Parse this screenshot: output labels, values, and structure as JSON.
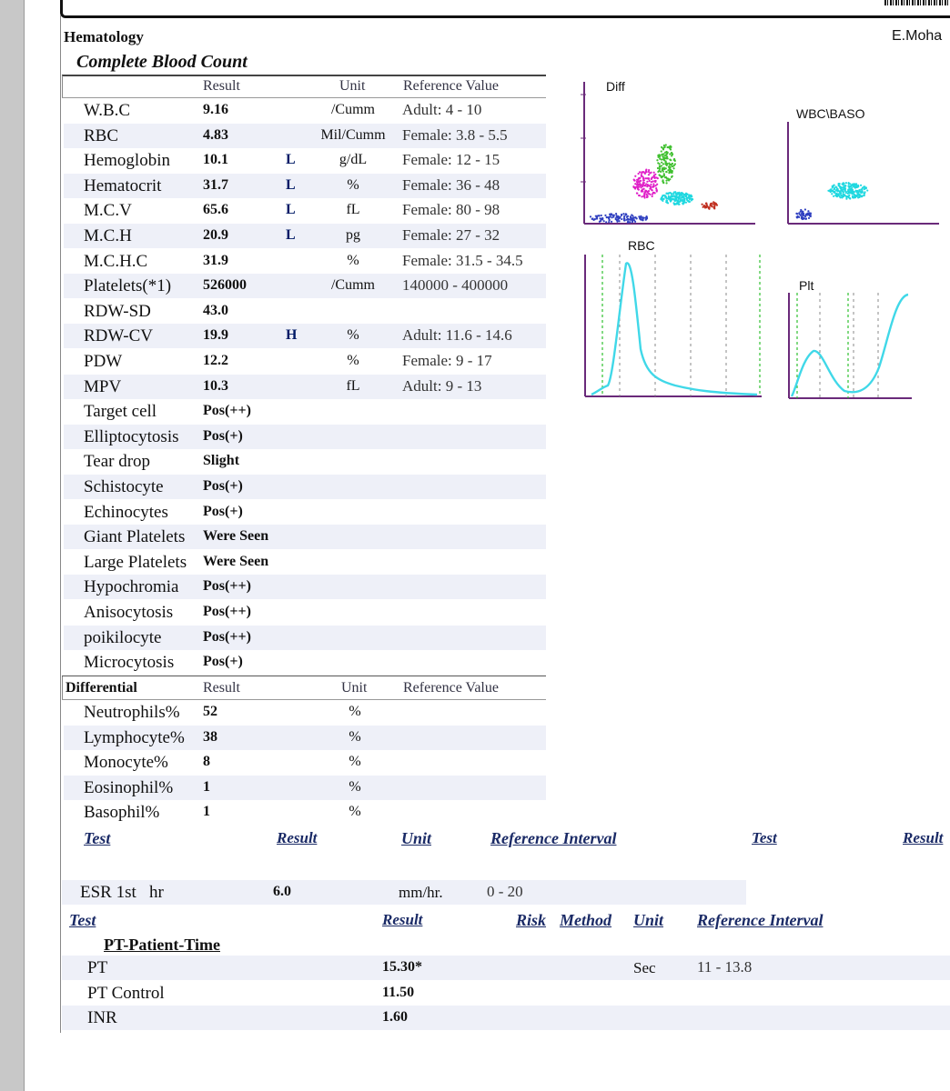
{
  "header": {
    "section": "Hematology",
    "author": "E.Moha"
  },
  "cbc": {
    "title": "Complete Blood Count",
    "col_result": "Result",
    "col_unit": "Unit",
    "col_ref": "Reference Value",
    "rows": [
      {
        "name": "W.B.C",
        "result": "9.16",
        "flag": "",
        "unit": "/Cumm",
        "ref": "Adult: 4 - 10"
      },
      {
        "name": "RBC",
        "result": "4.83",
        "flag": "",
        "unit": "Mil/Cumm",
        "ref": "Female: 3.8 - 5.5"
      },
      {
        "name": "Hemoglobin",
        "result": "10.1",
        "flag": "L",
        "unit": "g/dL",
        "ref": "Female: 12 - 15"
      },
      {
        "name": "Hematocrit",
        "result": "31.7",
        "flag": "L",
        "unit": "%",
        "ref": "Female: 36 - 48"
      },
      {
        "name": "M.C.V",
        "result": "65.6",
        "flag": "L",
        "unit": "fL",
        "ref": "Female: 80 - 98"
      },
      {
        "name": "M.C.H",
        "result": "20.9",
        "flag": "L",
        "unit": "pg",
        "ref": "Female: 27 - 32"
      },
      {
        "name": "M.C.H.C",
        "result": "31.9",
        "flag": "",
        "unit": "%",
        "ref": "Female: 31.5 - 34.5"
      },
      {
        "name": "Platelets(*1)",
        "result": "526000",
        "flag": "",
        "unit": "/Cumm",
        "ref": "140000 - 400000"
      },
      {
        "name": "RDW-SD",
        "result": "43.0",
        "flag": "",
        "unit": "",
        "ref": ""
      },
      {
        "name": "RDW-CV",
        "result": "19.9",
        "flag": "H",
        "unit": "%",
        "ref": "Adult: 11.6 - 14.6"
      },
      {
        "name": "PDW",
        "result": "12.2",
        "flag": "",
        "unit": "%",
        "ref": "Female: 9 - 17"
      },
      {
        "name": "MPV",
        "result": "10.3",
        "flag": "",
        "unit": "fL",
        "ref": "Adult: 9 - 13"
      },
      {
        "name": "Target cell",
        "result": "Pos(++)",
        "flag": "",
        "unit": "",
        "ref": ""
      },
      {
        "name": "Elliptocytosis",
        "result": "Pos(+)",
        "flag": "",
        "unit": "",
        "ref": ""
      },
      {
        "name": "Tear drop",
        "result": "Slight",
        "flag": "",
        "unit": "",
        "ref": ""
      },
      {
        "name": "Schistocyte",
        "result": "Pos(+)",
        "flag": "",
        "unit": "",
        "ref": ""
      },
      {
        "name": "Echinocytes",
        "result": "Pos(+)",
        "flag": "",
        "unit": "",
        "ref": ""
      },
      {
        "name": "Giant Platelets",
        "result": "Were Seen",
        "flag": "",
        "unit": "",
        "ref": ""
      },
      {
        "name": "Large Platelets",
        "result": "Were Seen",
        "flag": "",
        "unit": "",
        "ref": ""
      },
      {
        "name": "Hypochromia",
        "result": "Pos(++)",
        "flag": "",
        "unit": "",
        "ref": ""
      },
      {
        "name": "Anisocytosis",
        "result": "Pos(++)",
        "flag": "",
        "unit": "",
        "ref": ""
      },
      {
        "name": "poikilocyte",
        "result": "Pos(++)",
        "flag": "",
        "unit": "",
        "ref": ""
      },
      {
        "name": "Microcytosis",
        "result": "Pos(+)",
        "flag": "",
        "unit": "",
        "ref": ""
      }
    ]
  },
  "differential": {
    "title": "Differential",
    "col_result": "Result",
    "col_unit": "Unit",
    "col_ref": "Reference Value",
    "rows": [
      {
        "name": "Neutrophils%",
        "result": "52",
        "unit": "%"
      },
      {
        "name": "Lymphocyte%",
        "result": "38",
        "unit": "%"
      },
      {
        "name": "Monocyte%",
        "result": "8",
        "unit": "%"
      },
      {
        "name": "Eosinophil%",
        "result": "1",
        "unit": "%"
      },
      {
        "name": "Basophil%",
        "result": "1",
        "unit": "%"
      }
    ]
  },
  "esr": {
    "headers": {
      "test": "Test",
      "result": "Result",
      "unit": "Unit",
      "ref": "Reference Interval",
      "test2": "Test",
      "result2": "Result"
    },
    "row": {
      "name": "ESR 1st   hr",
      "result": "6.0",
      "unit": "mm/hr.",
      "ref": "0 - 20"
    }
  },
  "pt": {
    "headers": {
      "test": "Test",
      "result": "Result",
      "risk": "Risk",
      "method": "Method",
      "unit": "Unit",
      "ref": "Reference Interval"
    },
    "group": "PT-Patient-Time",
    "rows": [
      {
        "name": "PT",
        "result": "15.30*",
        "unit": "Sec",
        "ref": "11 - 13.8"
      },
      {
        "name": "PT Control",
        "result": "11.50",
        "unit": "",
        "ref": ""
      },
      {
        "name": "INR",
        "result": "1.60",
        "unit": "",
        "ref": ""
      }
    ]
  },
  "plots": {
    "diff": "Diff",
    "wbc": "WBC\\BASO",
    "rbc": "RBC",
    "plt": "Plt"
  },
  "colors": {
    "shade": "#eef0f8",
    "scatter_magenta": "#e020c8",
    "scatter_green": "#40c030",
    "scatter_cyan": "#20d8e0",
    "scatter_blue": "#3040c0",
    "scatter_red": "#c03020",
    "axis": "#6a2a7a",
    "hist": "#40d8e8",
    "marker_green": "#30c030"
  }
}
